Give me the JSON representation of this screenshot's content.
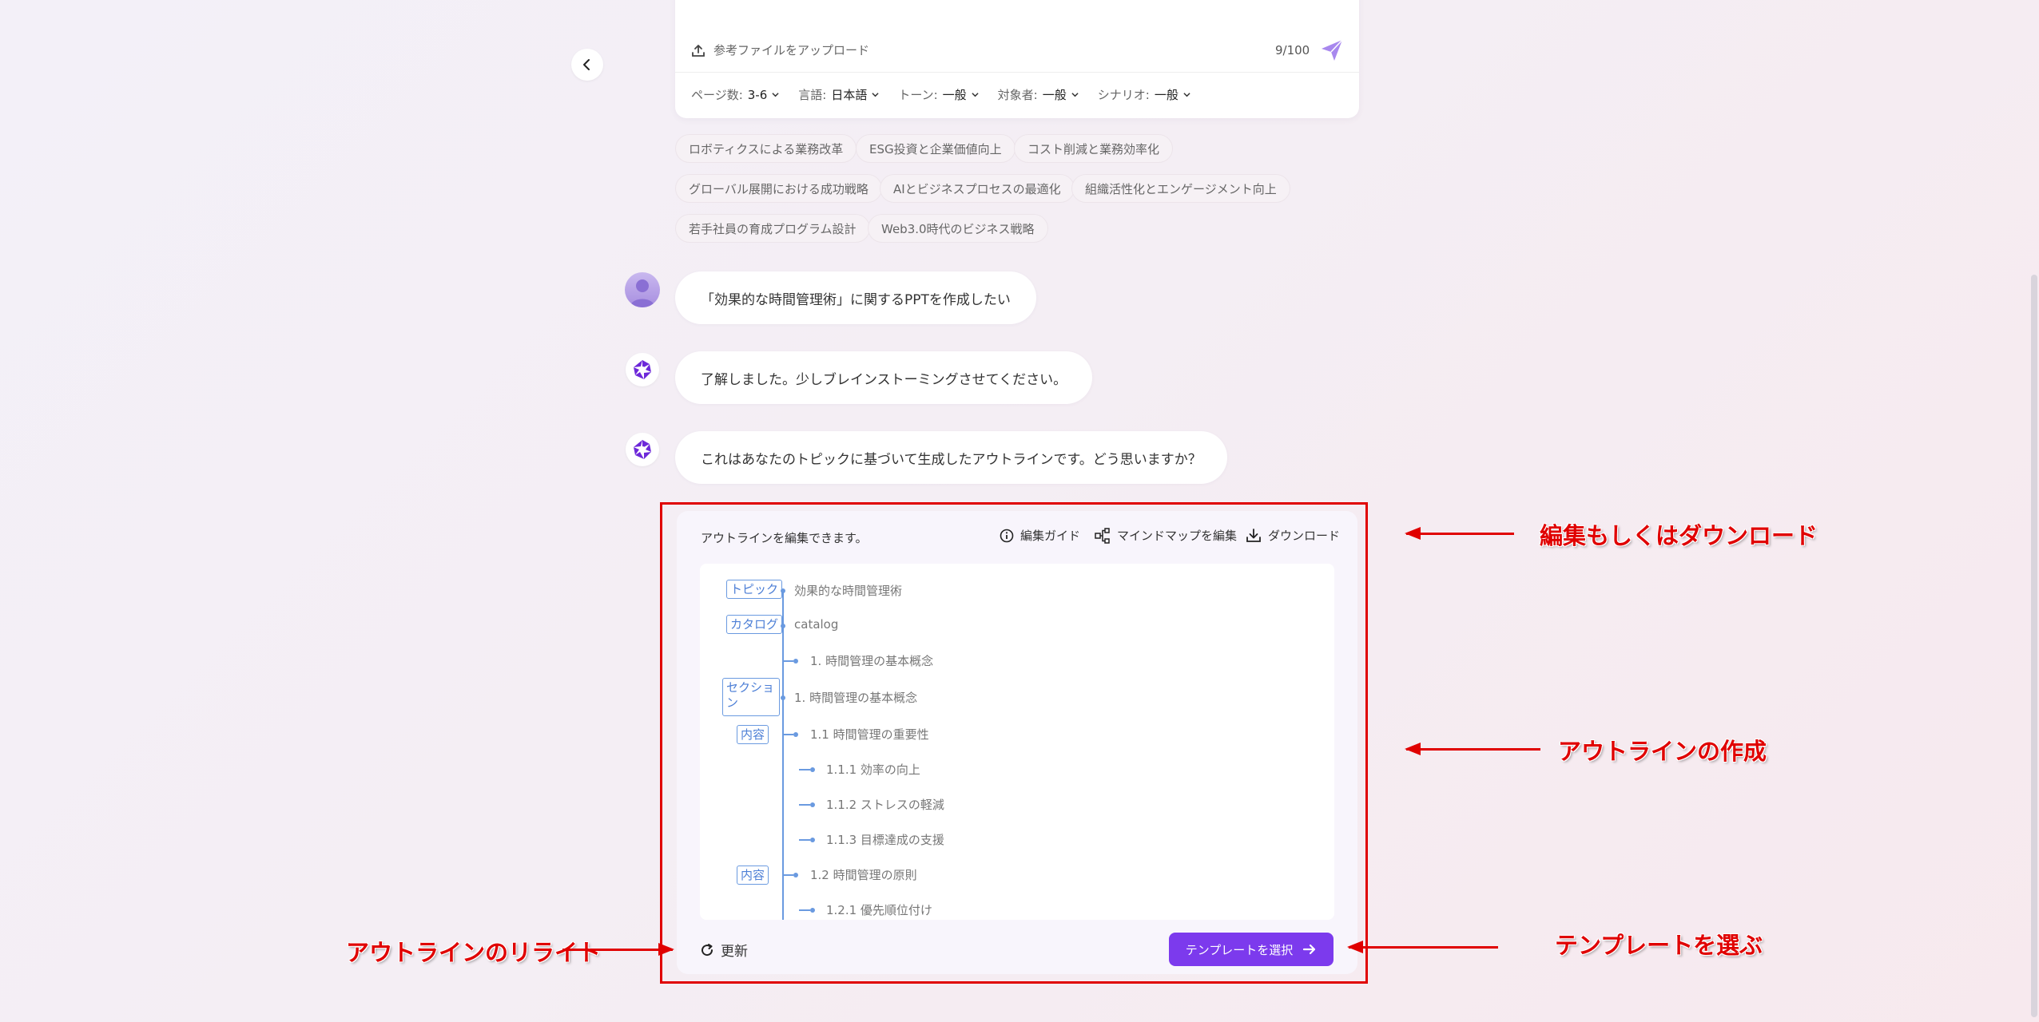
{
  "input": {
    "upload_label": "参考ファイルをアップロード",
    "counter": "9/100",
    "options": [
      {
        "label": "ページ数:",
        "value": "3-6"
      },
      {
        "label": "言語:",
        "value": "日本語"
      },
      {
        "label": "トーン:",
        "value": "一般"
      },
      {
        "label": "対象者:",
        "value": "一般"
      },
      {
        "label": "シナリオ:",
        "value": "一般"
      }
    ]
  },
  "suggestions": [
    "ロボティクスによる業務改革",
    "ESG投資と企業価値向上",
    "コスト削減と業務効率化",
    "グローバル展開における成功戦略",
    "AIとビジネスプロセスの最適化",
    "組織活性化とエンゲージメント向上",
    "若手社員の育成プログラム設計",
    "Web3.0時代のビジネス戦略"
  ],
  "chat": {
    "user_message": "「効果的な時間管理術」に関するPPTを作成したい",
    "bot_message_1": "了解しました。少しブレインストーミングさせてください。",
    "bot_message_2": "これはあなたのトピックに基づいて生成したアウトラインです。どう思いますか？"
  },
  "outline": {
    "header_text": "アウトラインを編集できます。",
    "tools": {
      "guide": "編集ガイド",
      "mindmap": "マインドマップを編集",
      "download": "ダウンロード"
    },
    "tags": {
      "topic": "トピック",
      "catalog": "カタログ",
      "section": "セクション",
      "content1": "内容",
      "content2": "内容"
    },
    "nodes": {
      "topic": "効果的な時間管理術",
      "catalog": "catalog",
      "catalog_item": "1. 時間管理の基本概念",
      "section": "1. 時間管理の基本概念",
      "c1": "1.1 時間管理の重要性",
      "c1_1": "1.1.1 効率の向上",
      "c1_2": "1.1.2 ストレスの軽減",
      "c1_3": "1.1.3 目標達成の支援",
      "c2": "1.2 時間管理の原則",
      "c2_1": "1.2.1 優先順位付け"
    },
    "refresh_label": "更新",
    "template_button": "テンプレートを選択"
  },
  "annotations": {
    "edit_download": "編集もしくはダウンロード",
    "create_outline": "アウトラインの作成",
    "rewrite_outline": "アウトラインのリライト",
    "choose_template": "テンプレートを選ぶ"
  },
  "colors": {
    "accent": "#7c3aed",
    "tree_line": "#6a9ae0",
    "annotation_red": "#e00000"
  }
}
